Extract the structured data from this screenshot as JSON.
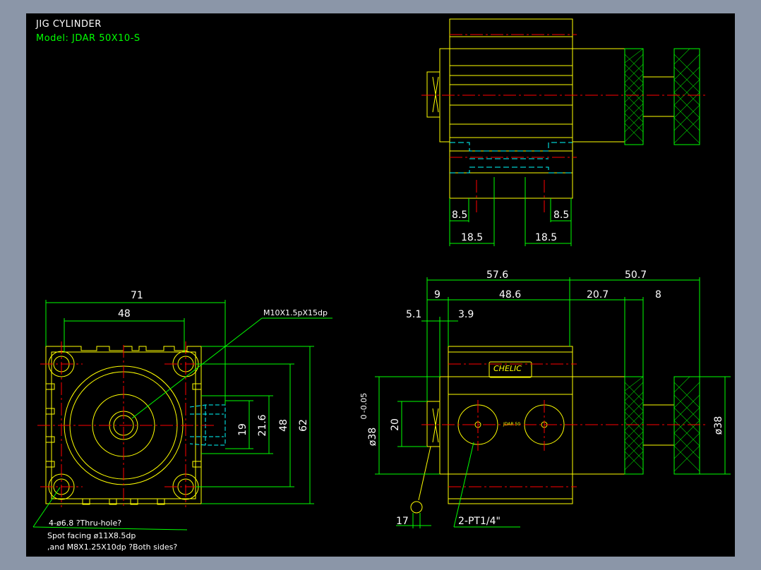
{
  "title": {
    "line1": "JIG CYLINDER",
    "line2": "Model:  JDAR  50X10-S"
  },
  "dims_top": {
    "left_inner": "8.5",
    "right_inner": "8.5",
    "left_outer": "18.5",
    "right_outer": "18.5"
  },
  "dims_front": {
    "width": "71",
    "hole_pitch": "48",
    "h19": "19",
    "h21_6": "21.6",
    "h48": "48",
    "h62": "62",
    "port_note": "M10X1.5pX15dp"
  },
  "notes_front": {
    "holes": "4-ø6.8 ?Thru-hole?",
    "spot": "Spot facing  ø11X8.5dp",
    "tap": ",and M8X1.25X10dp ?Both sides?"
  },
  "dims_side": {
    "total_left": "57.6",
    "total_right": "50.7",
    "d9": "9",
    "d48_6": "48.6",
    "d20_7": "20.7",
    "d8": "8",
    "d5_1": "5.1",
    "d3_9": "3.9",
    "bore": "ø38",
    "rod_dia_top": "0",
    "rod_dia": "ø38",
    "rod_dia_tol": "-0.05",
    "d20": "20",
    "d17": "17",
    "ports": "2-PT1/4\""
  },
  "label": {
    "brand": "CHELIC",
    "model_small": "JDAR 50"
  },
  "colors": {
    "background": "#000000",
    "frame": "#8b96a8",
    "outline": "#ffff00",
    "dimension": "#00ff00",
    "centerline": "#ff0000",
    "hidden": "#00ffff",
    "text": "#ffffff"
  }
}
